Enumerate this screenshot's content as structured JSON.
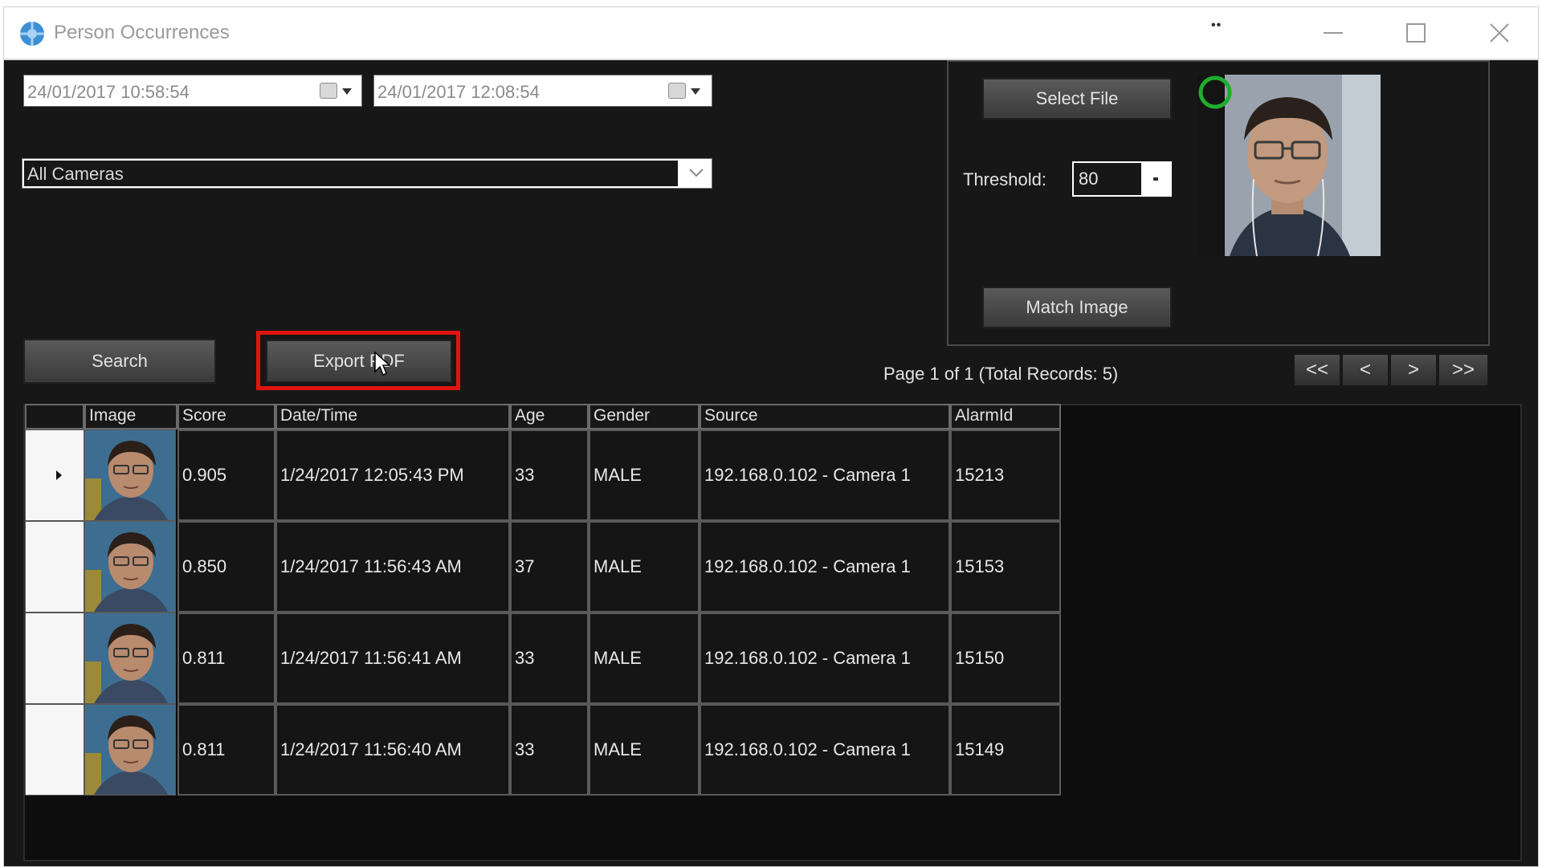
{
  "window": {
    "title": "Person Occurrences",
    "extra_indicator": "••"
  },
  "filters": {
    "start_datetime": "24/01/2017 10:58:54",
    "end_datetime": "24/01/2017 12:08:54",
    "camera": "All Cameras"
  },
  "buttons": {
    "search": "Search",
    "export_pdf": "Export PDF",
    "select_file": "Select File",
    "match_image": "Match Image"
  },
  "threshold": {
    "label": "Threshold:",
    "value": "80"
  },
  "pagination": {
    "status": "Page 1 of 1 (Total Records: 5)",
    "first": "<<",
    "prev": "<",
    "next": ">",
    "last": ">>"
  },
  "table": {
    "headers": [
      "Image",
      "Score",
      "Date/Time",
      "Age",
      "Gender",
      "Source",
      "AlarmId"
    ],
    "rows": [
      {
        "score": "0.905",
        "datetime": "1/24/2017 12:05:43 PM",
        "age": "33",
        "gender": "MALE",
        "source": "192.168.0.102 - Camera 1",
        "alarm_id": "15213"
      },
      {
        "score": "0.850",
        "datetime": "1/24/2017 11:56:43 AM",
        "age": "37",
        "gender": "MALE",
        "source": "192.168.0.102 - Camera 1",
        "alarm_id": "15153"
      },
      {
        "score": "0.811",
        "datetime": "1/24/2017 11:56:41 AM",
        "age": "33",
        "gender": "MALE",
        "source": "192.168.0.102 - Camera 1",
        "alarm_id": "15150"
      },
      {
        "score": "0.811",
        "datetime": "1/24/2017 11:56:40 AM",
        "age": "33",
        "gender": "MALE",
        "source": "192.168.0.102 - Camera 1",
        "alarm_id": "15149"
      }
    ]
  },
  "colors": {
    "background": "#171717",
    "highlight_frame": "#e0140f",
    "face_marker": "#1fae2e"
  }
}
